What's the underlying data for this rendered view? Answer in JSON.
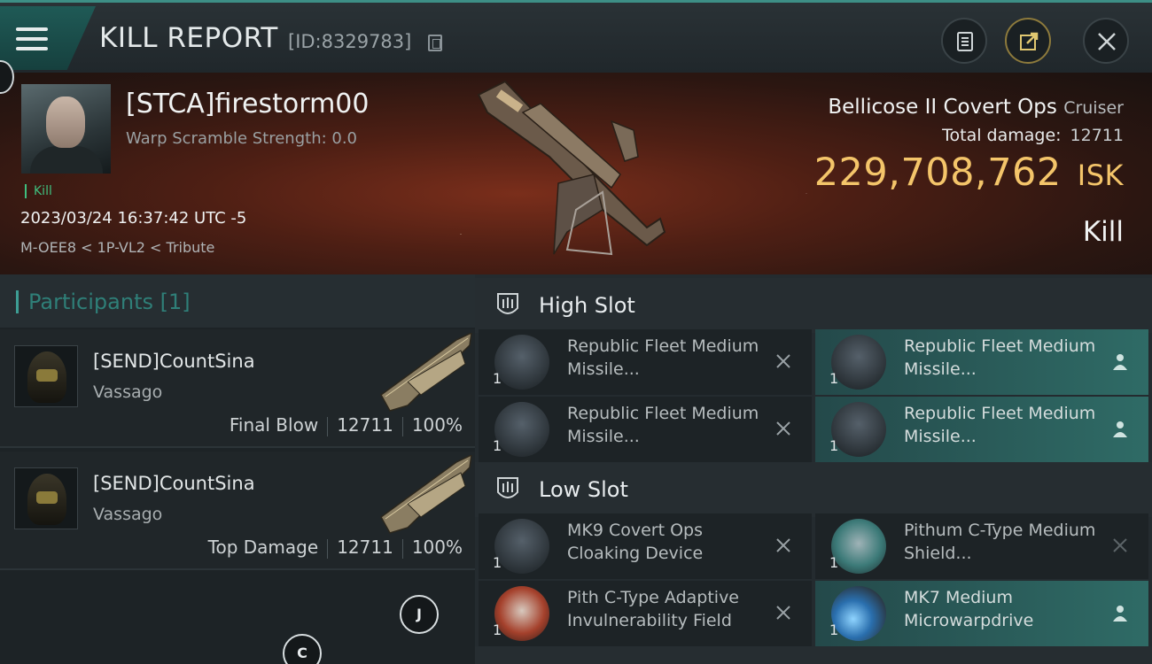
{
  "header": {
    "title": "KILL REPORT",
    "kill_id": "[ID:8329783]"
  },
  "victim": {
    "name": "[STCA]firestorm00",
    "warp_scramble": "Warp Scramble Strength: 0.0",
    "kill_tag": "Kill",
    "datetime": "2023/03/24 16:37:42 UTC -5",
    "location": "M-OEE8 < 1P-VL2 < Tribute",
    "ship_name": "Bellicose II Covert Ops",
    "ship_class": "Cruiser",
    "total_damage_label": "Total damage:",
    "total_damage_value": "12711",
    "isk_value": "229,708,762",
    "isk_unit": "ISK",
    "kill_type": "Kill"
  },
  "participants": {
    "title": "Participants [1]",
    "rows": [
      {
        "name": "[SEND]CountSina",
        "ship": "Vassago",
        "role": "Final Blow",
        "damage": "12711",
        "percent": "100%"
      },
      {
        "name": "[SEND]CountSina",
        "ship": "Vassago",
        "role": "Top Damage",
        "damage": "12711",
        "percent": "100%"
      }
    ]
  },
  "buttons": {
    "j": "J",
    "c": "C"
  },
  "fittings": {
    "high_slot": {
      "title": "High Slot",
      "modules": [
        {
          "name": "Republic Fleet Medium Missile...",
          "qty": "1",
          "icon": "missile-launcher-icon",
          "state": "destroyed"
        },
        {
          "name": "Republic Fleet Medium Missile...",
          "qty": "1",
          "icon": "missile-launcher-icon",
          "state": "dropped"
        },
        {
          "name": "Republic Fleet Medium Missile...",
          "qty": "1",
          "icon": "missile-launcher-icon",
          "state": "destroyed"
        },
        {
          "name": "Republic Fleet Medium Missile...",
          "qty": "1",
          "icon": "missile-launcher-icon",
          "state": "dropped"
        }
      ]
    },
    "low_slot": {
      "title": "Low Slot",
      "modules": [
        {
          "name": "MK9 Covert Ops Cloaking Device",
          "qty": "1",
          "icon": "cloaking-device-icon",
          "state": "destroyed"
        },
        {
          "name": "Pithum C-Type Medium Shield...",
          "qty": "1",
          "icon": "shield-extender-icon",
          "state": "destroyed"
        },
        {
          "name": "Pith C-Type Adaptive Invulnerability Field",
          "qty": "1",
          "icon": "invulnerability-field-icon",
          "state": "destroyed"
        },
        {
          "name": "MK7 Medium Microwarpdrive",
          "qty": "1",
          "icon": "microwarpdrive-icon",
          "state": "dropped"
        }
      ]
    }
  },
  "colors": {
    "accent": "#3d9e94",
    "isk": "#f4c56a",
    "dropped_bg": "#2f6b66",
    "kill_green": "#3fbf7e"
  }
}
